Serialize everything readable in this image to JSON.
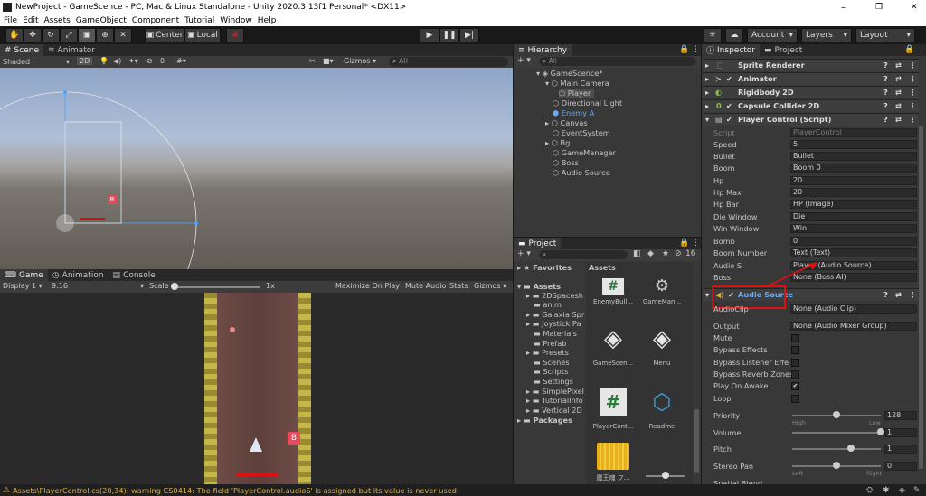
{
  "window": {
    "title": "NewProject - GameScence - PC, Mac & Linux Standalone - Unity 2020.3.13f1 Personal* <DX11>",
    "min": "–",
    "max": "❐",
    "close": "✕"
  },
  "menu": [
    "File",
    "Edit",
    "Assets",
    "GameObject",
    "Component",
    "Tutorial",
    "Window",
    "Help"
  ],
  "toolbar": {
    "center": "Center",
    "local": "Local",
    "account": "Account",
    "layers": "Layers",
    "layout": "Layout"
  },
  "scene": {
    "tabs": [
      "Scene",
      "Animator"
    ],
    "shading": "Shaded",
    "mode2d": "2D",
    "zero": "0",
    "gizmos": "Gizmos",
    "search": "All"
  },
  "game": {
    "tabs": [
      "Game",
      "Animation",
      "Console"
    ],
    "display": "Display 1",
    "aspect": "9:16",
    "scale": "Scale",
    "scale_val": "1x",
    "maximize": "Maximize On Play",
    "mute": "Mute Audio",
    "stats": "Stats",
    "gizmos": "Gizmos",
    "boss_badge": "B"
  },
  "hierarchy": {
    "tab": "Hierarchy",
    "search": "All",
    "items": [
      "GameScence*",
      "Main Camera",
      "Player",
      "Directional Light",
      "Enemy A",
      "Canvas",
      "EventSystem",
      "Bg",
      "GameManager",
      "Boss",
      "Audio Source"
    ]
  },
  "project": {
    "tab": "Project",
    "count": "16",
    "favorites": "Favorites",
    "assets_root": "Assets",
    "folders": [
      "2DSpacesh",
      "anim",
      "Galaxia Spr",
      "Joystick Pa",
      "Materials",
      "Prefab",
      "Presets",
      "Scenes",
      "Scripts",
      "Settings",
      "SimplePixel",
      "TutorialInfo",
      "Vertical 2D"
    ],
    "packages": "Packages",
    "assets_header": "Assets",
    "asset_names": [
      "EnemyBull...",
      "GameMan...",
      "GameScen...",
      "Menu",
      "PlayerCont...",
      "Readme",
      "魔王魂 フ..."
    ]
  },
  "inspector": {
    "tabs": [
      "Inspector",
      "Project"
    ],
    "components": [
      "Sprite Renderer",
      "Animator",
      "Rigidbody 2D",
      "Capsule Collider 2D",
      "Player Control (Script)"
    ],
    "fields": [
      {
        "label": "Script",
        "value": "PlayerControl"
      },
      {
        "label": "Speed",
        "value": "5"
      },
      {
        "label": "Bullet",
        "value": "Bullet"
      },
      {
        "label": "Boom",
        "value": "Boom 0"
      },
      {
        "label": "Hp",
        "value": "20"
      },
      {
        "label": "Hp Max",
        "value": "20"
      },
      {
        "label": "Hp Bar",
        "value": "HP (Image)"
      },
      {
        "label": "Die Window",
        "value": "Die"
      },
      {
        "label": "Win Window",
        "value": "Win"
      },
      {
        "label": "Bomb",
        "value": "0"
      },
      {
        "label": "Boom Number",
        "value": "Text (Text)"
      },
      {
        "label": "Audio S",
        "value": "Player (Audio Source)"
      },
      {
        "label": "Boss",
        "value": "None (Boss AI)"
      }
    ],
    "audio_header": "Audio Source",
    "audio_fields": [
      {
        "label": "AudioClip",
        "value": "None (Audio Clip)"
      },
      {
        "label": "Output",
        "value": "None (Audio Mixer Group)"
      }
    ],
    "toggles": [
      "Mute",
      "Bypass Effects",
      "Bypass Listener Effects",
      "Bypass Reverb Zones",
      "Play On Awake",
      "Loop"
    ],
    "priority": {
      "label": "Priority",
      "value": "128",
      "low": "High",
      "high": "Low",
      "level": 0.5
    },
    "volume": {
      "label": "Volume",
      "value": "1",
      "level": 1.0
    },
    "pitch": {
      "label": "Pitch",
      "value": "1",
      "level": 0.67
    },
    "stereo": {
      "label": "Stereo Pan",
      "value": "0",
      "left": "Left",
      "right": "Right",
      "level": 0.5
    },
    "spatial": "Spatial Blend"
  },
  "status": {
    "text": "Assets\\PlayerControl.cs(20,34): warning CS0414: The field 'PlayerControl.audioS' is assigned but its value is never used"
  },
  "colors": {
    "accent": "#4d8ad8",
    "warn": "#e0b040",
    "annotation": "#e01010"
  }
}
